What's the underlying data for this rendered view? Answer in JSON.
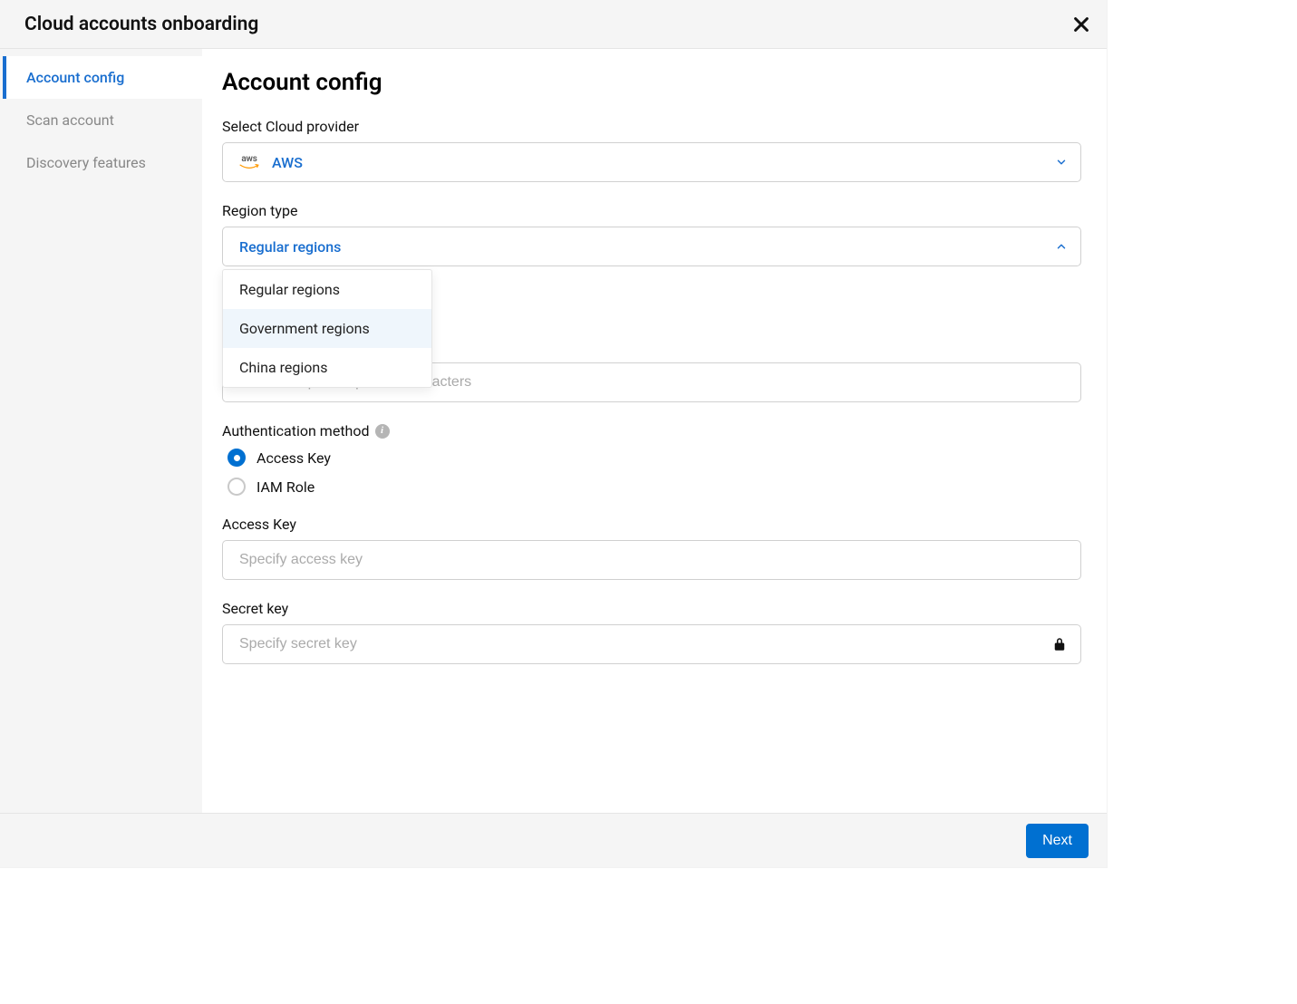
{
  "header": {
    "title": "Cloud accounts onboarding"
  },
  "sidebar": {
    "items": [
      {
        "label": "Account config",
        "active": true
      },
      {
        "label": "Scan account",
        "active": false
      },
      {
        "label": "Discovery features",
        "active": false
      }
    ]
  },
  "content": {
    "title": "Account config",
    "provider_label": "Select Cloud provider",
    "provider_value": "AWS",
    "region_type_label": "Region type",
    "region_type_value": "Regular regions",
    "region_options": [
      "Regular regions",
      "Government regions",
      "China regions"
    ],
    "region_highlight_index": 1,
    "description_placeholder": "Add description, up to 30 characters",
    "auth_label": "Authentication method",
    "auth_options": [
      {
        "label": "Access Key",
        "checked": true
      },
      {
        "label": "IAM Role",
        "checked": false
      }
    ],
    "access_key_label": "Access Key",
    "access_key_placeholder": "Specify access key",
    "secret_key_label": "Secret key",
    "secret_key_placeholder": "Specify secret key"
  },
  "footer": {
    "next_label": "Next"
  }
}
